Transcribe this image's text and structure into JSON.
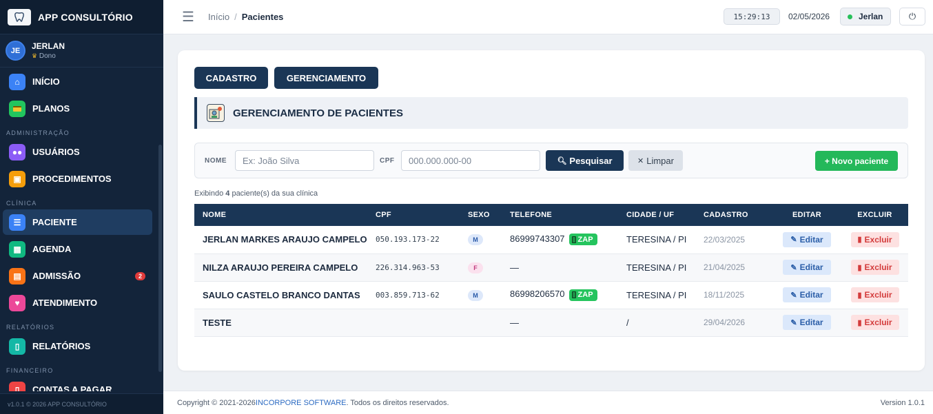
{
  "app": {
    "title": "APP CONSULTÓRIO",
    "logo_icon": "tooth-icon"
  },
  "user": {
    "initials": "JE",
    "name": "JERLAN",
    "role": "Dono"
  },
  "nav": {
    "items_top": [
      {
        "label": "INÍCIO",
        "icon": "home-icon",
        "color": "#3b82f6"
      },
      {
        "label": "PLANOS",
        "icon": "card-icon",
        "color": "#22c55e"
      }
    ],
    "section_admin": "ADMINISTRAÇÃO",
    "items_admin": [
      {
        "label": "USUÁRIOS",
        "icon": "users-icon",
        "color": "#8b5cf6"
      },
      {
        "label": "PROCEDIMENTOS",
        "icon": "briefcase-icon",
        "color": "#f59e0b"
      }
    ],
    "section_clinica": "CLÍNICA",
    "items_clinica": [
      {
        "label": "PACIENTE",
        "icon": "id-card-icon",
        "color": "#3b82f6"
      },
      {
        "label": "AGENDA",
        "icon": "calendar-icon",
        "color": "#10b981"
      },
      {
        "label": "ADMISSÃO",
        "icon": "clipboard-icon",
        "color": "#f97316",
        "badge": "2"
      },
      {
        "label": "ATENDIMENTO",
        "icon": "tooth-icon",
        "color": "#ec4899"
      }
    ],
    "section_relatorios": "RELATÓRIOS",
    "items_relatorios": [
      {
        "label": "RELATÓRIOS",
        "icon": "document-icon",
        "color": "#14b8a6"
      }
    ],
    "section_financeiro": "FINANCEIRO",
    "items_financeiro": [
      {
        "label": "CONTAS A PAGAR",
        "icon": "bill-icon",
        "color": "#ef4444"
      }
    ],
    "footer": "v1.0.1 © 2026 APP CONSULTÓRIO"
  },
  "topbar": {
    "breadcrumb_home": "Início",
    "breadcrumb_sep": "/",
    "breadcrumb_current": "Pacientes",
    "clock": "15:29:13",
    "date": "02/05/2026",
    "user": "Jerlan"
  },
  "tabs": {
    "cadastro": "CADASTRO",
    "gerenciamento": "GERENCIAMENTO"
  },
  "section_title": "GERENCIAMENTO DE PACIENTES",
  "filter": {
    "name_label": "NOME",
    "name_placeholder": "Ex: João Silva",
    "cpf_label": "CPF",
    "cpf_placeholder": "000.000.000-00",
    "search_label": "Pesquisar",
    "clear_label": "Limpar",
    "new_label": "+ Novo paciente"
  },
  "summary": {
    "prefix": "Exibindo ",
    "count": "4",
    "suffix": " paciente(s) da sua clínica"
  },
  "table": {
    "headers": {
      "nome": "NOME",
      "cpf": "CPF",
      "sexo": "SEXO",
      "telefone": "TELEFONE",
      "cidade": "CIDADE / UF",
      "cadastro": "CADASTRO",
      "editar": "EDITAR",
      "excluir": "EXCLUIR"
    },
    "edit_label": "Editar",
    "delete_label": "Excluir",
    "zap_label": "ZAP",
    "rows": [
      {
        "nome": "JERLAN MARKES ARAUJO CAMPELO",
        "cpf": "050.193.173-22",
        "sexo": "M",
        "telefone": "86999743307",
        "zap": true,
        "cidade": "TERESINA / PI",
        "cadastro": "22/03/2025"
      },
      {
        "nome": "NILZA ARAUJO PEREIRA CAMPELO",
        "cpf": "226.314.963-53",
        "sexo": "F",
        "telefone": "—",
        "zap": false,
        "cidade": "TERESINA / PI",
        "cadastro": "21/04/2025"
      },
      {
        "nome": "SAULO CASTELO BRANCO DANTAS",
        "cpf": "003.859.713-62",
        "sexo": "M",
        "telefone": "86998206570",
        "zap": true,
        "cidade": "TERESINA / PI",
        "cadastro": "18/11/2025"
      },
      {
        "nome": "TESTE",
        "cpf": "",
        "sexo": "",
        "telefone": "—",
        "zap": false,
        "cidade": "/",
        "cadastro": "29/04/2026"
      }
    ]
  },
  "footer": {
    "copyright_prefix": "Copyright © 2021-2026 ",
    "company": "INCORPORE SOFTWARE",
    "copyright_suffix": ". Todos os direitos reservados.",
    "version": "Version 1.0.1"
  }
}
